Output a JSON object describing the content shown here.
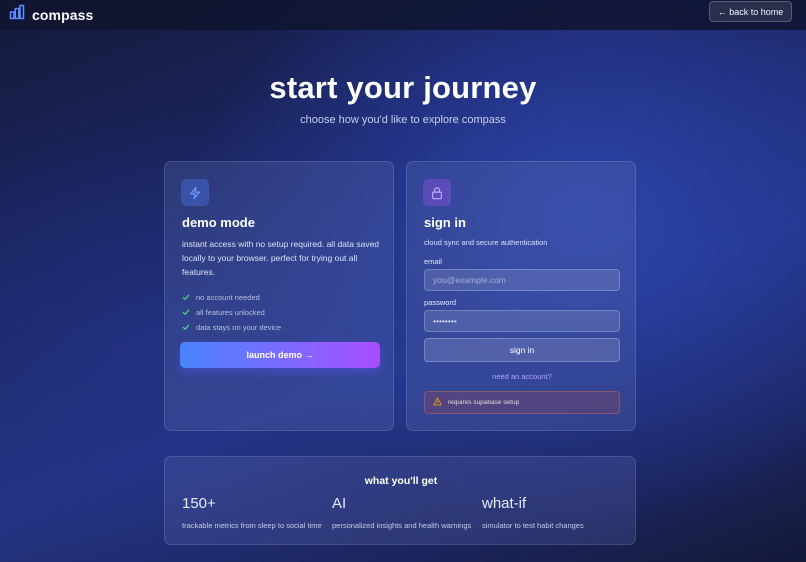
{
  "header": {
    "brand_name": "compass",
    "back_button_label": "← back to home"
  },
  "hero": {
    "title": "start your journey",
    "subtitle": "choose how you'd like to explore compass"
  },
  "demo_card": {
    "icon": "lightning-icon",
    "title": "demo mode",
    "description": "instant access with no setup required. all data saved locally to your browser. perfect for trying out all features.",
    "features": [
      "no account needed",
      "all features unlocked",
      "data stays on your device"
    ],
    "launch_button_label": "launch demo →"
  },
  "signin_card": {
    "icon": "lock-icon",
    "title": "sign in",
    "subtitle": "cloud sync and secure authentication",
    "email_label": "email",
    "email_placeholder": "you@example.com",
    "password_label": "password",
    "password_value": "••••••••",
    "signin_button_label": "sign in",
    "need_account_link": "need an account?",
    "warning_text": "requires supabase setup"
  },
  "benefits": {
    "title": "what you'll get",
    "stats": [
      {
        "value": "150+",
        "label": "trackable metrics from sleep to social time"
      },
      {
        "value": "AI",
        "label": "personalized insights and health warnings"
      },
      {
        "value": "what-if",
        "label": "simulator to test habit changes"
      }
    ]
  },
  "colors": {
    "accent_blue": "#4a84ff",
    "accent_purple": "#a74dff",
    "link_purple": "#b7a0ff",
    "warning_orange": "#f59e0b"
  }
}
